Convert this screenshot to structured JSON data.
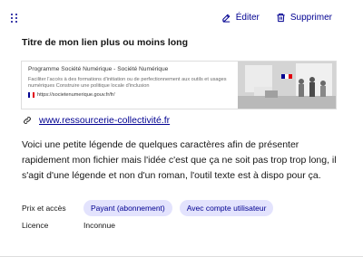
{
  "toolbar": {
    "edit_label": "Éditer",
    "delete_label": "Supprimer"
  },
  "link_block": {
    "title": "Titre de mon lien plus ou moins long",
    "preview": {
      "site_name": "Programme Société Numérique - Société Numérique",
      "description": "Faciliter l'accès à des formations d'initiation ou de perfectionnement aux outils et usages numériques Construire une politique locale d'inclusion",
      "url": "https://societenumerique.gouv.fr/fr/"
    },
    "link_text": "www.ressourcerie-collectivité.fr",
    "legend": "Voici une petite légende de quelques caractères afin de présenter rapidement mon fichier mais l'idée c'est que ça ne soit pas trop trop long, il s'agit d'une légende et non d'un roman, l'outil texte est à dispo pour ça.",
    "price_label": "Prix et accès",
    "tags": [
      "Payant (abonnement)",
      "Avec compte utilisateur"
    ],
    "licence_label": "Licence",
    "licence_value": "Inconnue"
  },
  "colors": {
    "accent": "#000091",
    "tag_bg": "#e3e3fd",
    "text": "#161616",
    "border": "#dddddd"
  }
}
